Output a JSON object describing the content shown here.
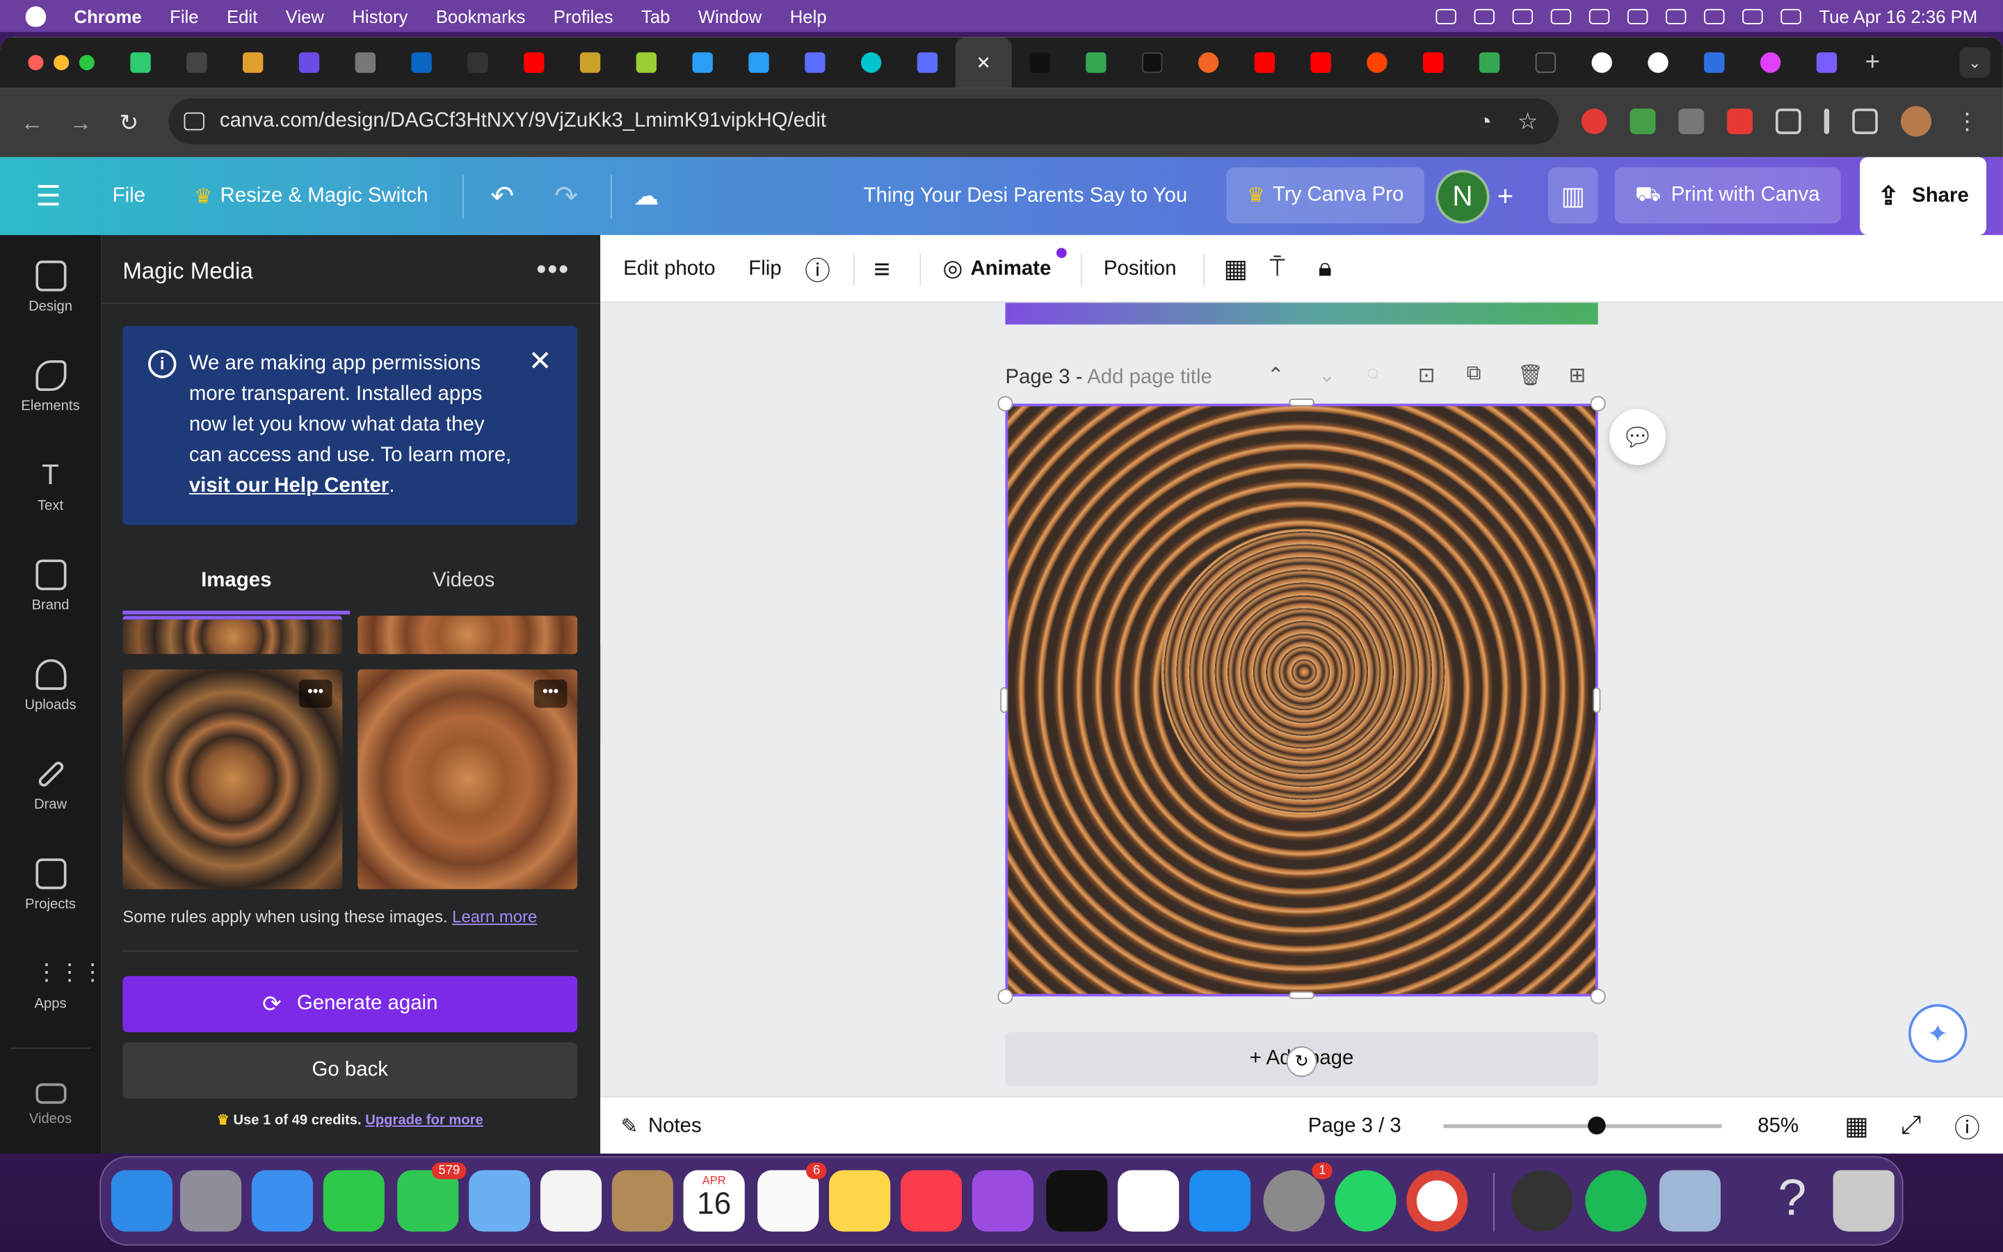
{
  "menubar": {
    "app": "Chrome",
    "items": [
      "File",
      "Edit",
      "View",
      "History",
      "Bookmarks",
      "Profiles",
      "Tab",
      "Window",
      "Help"
    ],
    "datetime": "Tue Apr 16  2:36 PM"
  },
  "browser": {
    "url": "canva.com/design/DAGCf3HtNXY/9VjZuKk3_LmimK91vipkHQ/edit",
    "new_tab": "+"
  },
  "canva_bar": {
    "menu": "File",
    "resize": "Resize & Magic Switch",
    "design_title": "Thing Your Desi Parents Say to You",
    "try_pro": "Try Canva Pro",
    "avatar_letter": "N",
    "print": "Print with Canva",
    "share": "Share"
  },
  "rail": [
    "Design",
    "Elements",
    "Text",
    "Brand",
    "Uploads",
    "Draw",
    "Projects",
    "Apps",
    "Videos"
  ],
  "panel": {
    "title": "Magic Media",
    "notice": {
      "text": "We are making app permissions more transparent. Installed apps now let you know what data they can access and use. To learn more, ",
      "link": "visit our Help Center",
      "end": "."
    },
    "tabs": [
      "Images",
      "Videos"
    ],
    "rules_text": "Some rules apply when using these images. ",
    "rules_link": "Learn more",
    "generate": "Generate again",
    "go_back": "Go back",
    "credits": "Use 1 of 49 credits. ",
    "credits_link": "Upgrade for more"
  },
  "toolbar": {
    "edit_photo": "Edit photo",
    "flip": "Flip",
    "animate": "Animate",
    "position": "Position"
  },
  "page": {
    "label": "Page 3 - ",
    "placeholder": "Add page title",
    "add_page": "+ Add page"
  },
  "footer": {
    "notes": "Notes",
    "page_indicator": "Page 3 / 3",
    "zoom": "85%"
  },
  "dock": {
    "messages_badge": "579",
    "calendar_month": "APR",
    "calendar_day": "16",
    "reminders_badge": "6",
    "settings_badge": "1"
  }
}
